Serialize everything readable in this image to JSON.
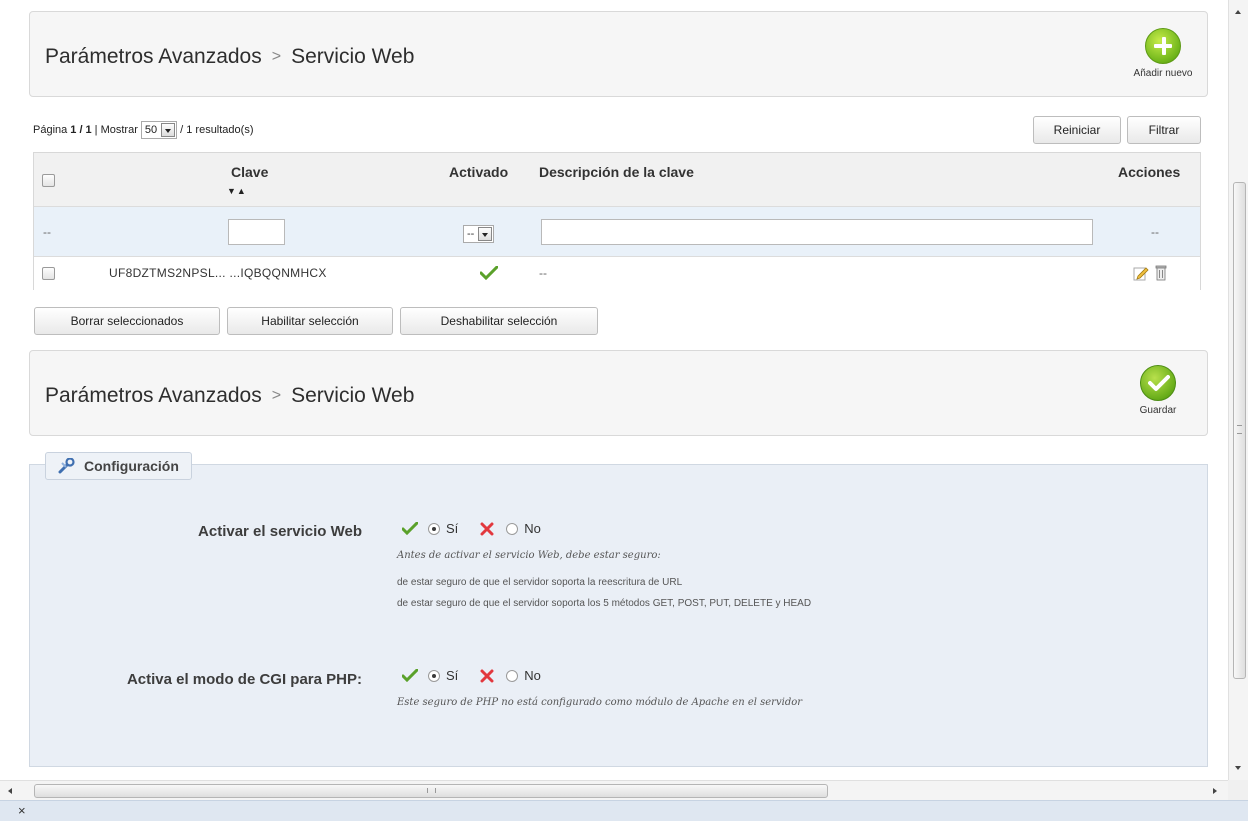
{
  "header_top": {
    "breadcrumb": [
      "Parámetros Avanzados",
      "Servicio Web"
    ],
    "separator": ">",
    "add_new_label": "Añadir nuevo"
  },
  "pager": {
    "prefix": "Página",
    "page": "1 / 1",
    "show_label": "| Mostrar",
    "per_page": "50",
    "results": "/ 1 resultado(s)"
  },
  "filter_buttons": {
    "reset": "Reiniciar",
    "filter": "Filtrar"
  },
  "table": {
    "columns": {
      "key": "Clave",
      "active": "Activado",
      "description": "Descripción de la clave",
      "actions": "Acciones"
    },
    "sort_icons": "▼▲",
    "filter_row": {
      "checkbox_placeholder": "--",
      "active_select": "--",
      "actions_placeholder": "--"
    },
    "rows": [
      {
        "key": "UF8DZTMS2NPSL... ...IQBQQNMHCX",
        "active": true,
        "description": "--"
      }
    ]
  },
  "bulk_actions": {
    "delete": "Borrar seleccionados",
    "enable": "Habilitar selección",
    "disable": "Deshabilitar selección"
  },
  "header_bottom": {
    "breadcrumb": [
      "Parámetros Avanzados",
      "Servicio Web"
    ],
    "separator": ">",
    "save_label": "Guardar"
  },
  "config": {
    "legend": "Configuración",
    "fields": [
      {
        "label": "Activar el servicio Web",
        "yes": "Sí",
        "no": "No",
        "selected": "yes",
        "hint_italic": "Antes de activar el servicio Web, debe estar seguro:",
        "hints": [
          "de estar seguro de que el servidor soporta la reescritura de URL",
          "de estar seguro de que el servidor soporta los 5 métodos GET, POST, PUT, DELETE y HEAD"
        ]
      },
      {
        "label": "Activa el modo de CGI para PHP:",
        "yes": "Sí",
        "no": "No",
        "selected": "yes",
        "hint_italic": "Este seguro de PHP no está configurado como módulo de Apache en el servidor"
      }
    ]
  },
  "bottom_bar": {
    "close": "×"
  },
  "hscroll_grip": "III",
  "colors": {
    "accent_green": "#6fb51a",
    "cross_red": "#e2383e",
    "filter_row_bg": "#e9f1f9",
    "fieldset_bg": "#eaeff6"
  }
}
